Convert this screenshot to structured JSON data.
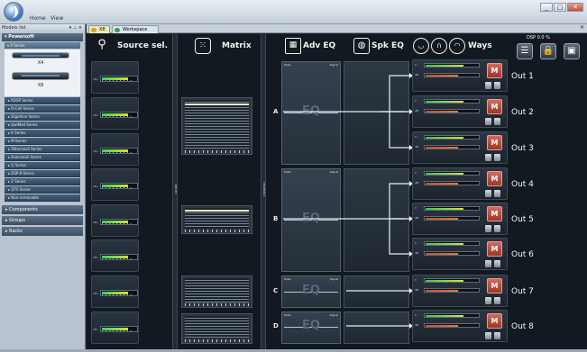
{
  "window": {
    "minimize": "_",
    "maximize": "□",
    "close": "✕"
  },
  "menu": {
    "home": "Home",
    "view": "View"
  },
  "models_panel": {
    "title": "Models list",
    "pin": "▾ ⊥ ✕",
    "powersoft": "▾ Powersoft",
    "x_series": "▾ X Series",
    "devices": [
      "X4",
      "X8"
    ],
    "series": [
      "KDSP Series",
      "D-Cell Series",
      "Digidrive Series",
      "IpalMod Series",
      "K Series",
      "M Series",
      "Ottocanali Series",
      "Duecanali Series",
      "Q Series",
      "DSP-8 Series",
      "Z Series",
      "QTS Series",
      "Non-removable"
    ],
    "sections": [
      "Components",
      "Groups",
      "Racks"
    ]
  },
  "tabs": {
    "device": "X8",
    "workspace": "Workspace",
    "close": "✕"
  },
  "header": {
    "source_sel": "Source sel.",
    "matrix": "Matrix",
    "adv_eq": "Adv EQ",
    "spk_eq": "Spk EQ",
    "ways": "Ways",
    "dsp": "DSP 0.0 %",
    "icons": {
      "source": "source-select-icon",
      "matrix": "matrix-grid-icon",
      "adv_eq": "adv-eq-icon",
      "spk_eq": "speaker-icon",
      "ways": "crossover-ways-icon"
    }
  },
  "input_label": "dBu",
  "matrix_labels": {
    "inputs": "INPUTS",
    "channels": "CHANNELS"
  },
  "eq": {
    "mute": "Mute",
    "signal": "Signal",
    "text": "EQ"
  },
  "channels": [
    "A",
    "B",
    "C",
    "D"
  ],
  "outputs": [
    "Out 1",
    "Out 2",
    "Out 3",
    "Out 4",
    "Out 5",
    "Out 6",
    "Out 7",
    "Out 8"
  ],
  "out_strip": {
    "v": "V",
    "db": "dB",
    "mute": "M"
  }
}
